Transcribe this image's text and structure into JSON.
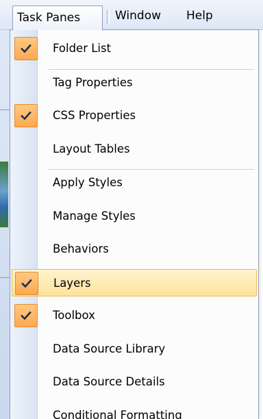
{
  "menubar": {
    "items": [
      {
        "label": "Task Panes",
        "active": true
      },
      {
        "label": "Window",
        "active": false
      },
      {
        "label": "Help",
        "active": false
      }
    ]
  },
  "menu": {
    "groups": [
      {
        "items": [
          {
            "label": "Folder List",
            "checked": true,
            "highlighted": false
          }
        ]
      },
      {
        "items": [
          {
            "label": "Tag Properties",
            "checked": false,
            "highlighted": false
          },
          {
            "label": "CSS Properties",
            "checked": true,
            "highlighted": false
          },
          {
            "label": "Layout Tables",
            "checked": false,
            "highlighted": false
          }
        ]
      },
      {
        "items": [
          {
            "label": "Apply Styles",
            "checked": false,
            "highlighted": false
          },
          {
            "label": "Manage Styles",
            "checked": false,
            "highlighted": false
          },
          {
            "label": "Behaviors",
            "checked": false,
            "highlighted": false
          },
          {
            "label": "Layers",
            "checked": true,
            "highlighted": true
          },
          {
            "label": "Toolbox",
            "checked": true,
            "highlighted": false
          },
          {
            "label": "Data Source Library",
            "checked": false,
            "highlighted": false
          },
          {
            "label": "Data Source Details",
            "checked": false,
            "highlighted": false
          },
          {
            "label": "Conditional Formatting",
            "checked": false,
            "highlighted": false
          }
        ]
      }
    ]
  },
  "colors": {
    "check_fill": "#fba94f",
    "highlight_fill": "#fde39a",
    "menu_border": "#8e9fbd"
  },
  "icons": {
    "check": "checkmark-icon"
  }
}
